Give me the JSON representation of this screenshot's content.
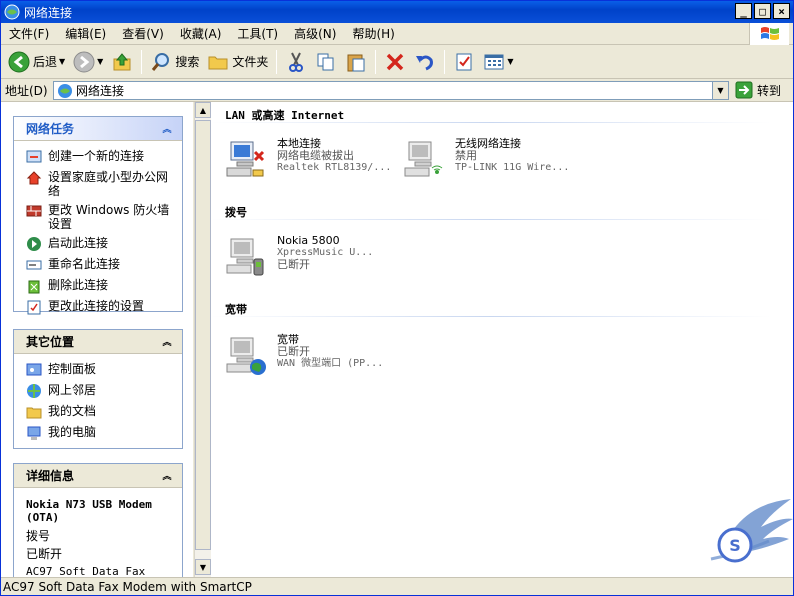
{
  "window": {
    "title": "网络连接"
  },
  "menu": [
    "文件(F)",
    "编辑(E)",
    "查看(V)",
    "收藏(A)",
    "工具(T)",
    "高级(N)",
    "帮助(H)"
  ],
  "toolbar": {
    "back_label": "后退",
    "search_label": "搜索",
    "folders_label": "文件夹"
  },
  "address": {
    "label": "地址(D)",
    "value": "网络连接",
    "go_label": "转到"
  },
  "tasks_panel": {
    "title": "网络任务",
    "items": [
      "创建一个新的连接",
      "设置家庭或小型办公网络",
      "更改 Windows 防火墙设置",
      "启动此连接",
      "重命名此连接",
      "删除此连接",
      "更改此连接的设置"
    ]
  },
  "places_panel": {
    "title": "其它位置",
    "items": [
      "控制面板",
      "网上邻居",
      "我的文档",
      "我的电脑"
    ]
  },
  "details_panel": {
    "title": "详细信息",
    "device_title": "Nokia N73 USB Modem (OTA)",
    "type": "拨号",
    "status": "已断开",
    "extra": "AC97 Soft Data Fax"
  },
  "groups": {
    "lan": {
      "title": "LAN 或高速 Internet",
      "items": [
        {
          "name": "本地连接",
          "status": "网络电缆被拔出",
          "device": "Realtek RTL8139/..."
        },
        {
          "name": "无线网络连接",
          "status": "禁用",
          "device": "TP-LINK 11G Wire..."
        }
      ]
    },
    "dialup": {
      "title": "拨号",
      "items": [
        {
          "name": "Nokia 5800",
          "status": "XpressMusic U...",
          "device": "已断开"
        }
      ]
    },
    "broadband": {
      "title": "宽带",
      "items": [
        {
          "name": "宽带",
          "status": "已断开",
          "device": "WAN 微型端口 (PP..."
        }
      ]
    }
  },
  "statusbar": {
    "text": "AC97 Soft Data Fax Modem with SmartCP"
  },
  "colors": {
    "title_bar": "#0a5fe8",
    "panel_head_text": "#215dc6",
    "window_bg": "#ece9d8"
  }
}
